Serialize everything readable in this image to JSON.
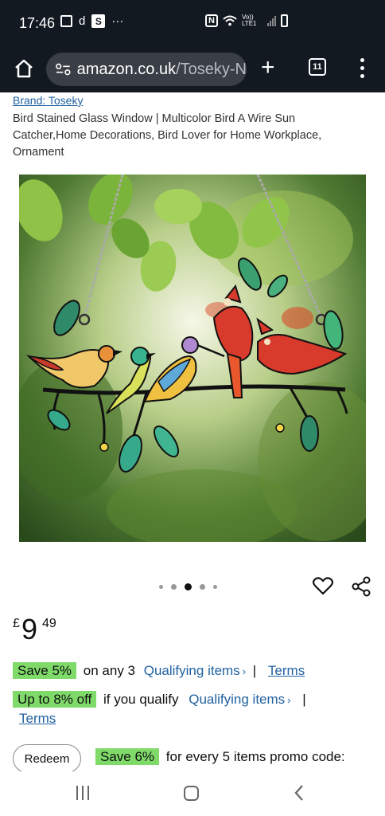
{
  "status_bar": {
    "time": "17:46",
    "notif_letter": "d",
    "notif_s": "S",
    "more": "···",
    "nfc": "N",
    "volte": "Vo)) LTE1"
  },
  "browser": {
    "domain": "amazon.co.uk",
    "path": "/Toseky-N",
    "tabs_count": "11",
    "new_tab_label": "+"
  },
  "product": {
    "brand": "Brand: Toseky",
    "title": "Bird Stained Glass Window | Multicolor Bird A Wire Sun Catcher,Home Decorations, Bird Lover for Home Workplace, Ornament",
    "image_count": 5,
    "active_image_index": 2,
    "price": {
      "currency": "£",
      "whole": "9",
      "fraction": "49"
    }
  },
  "offers": {
    "save5": {
      "badge": "Save 5%",
      "text": "on any 3",
      "link": "Qualifying items",
      "sep": "|",
      "terms": "Terms"
    },
    "upto8": {
      "badge": "Up to 8% off",
      "text": "if you qualify",
      "link": "Qualifying items",
      "sep": "|",
      "terms": "Terms"
    },
    "promo": {
      "button": "Redeem",
      "badge": "Save 6%",
      "text": "for every 5 items promo code:"
    }
  },
  "colors": {
    "header_bg": "#131921",
    "link": "#2162a1",
    "highlight": "#7fda69"
  }
}
